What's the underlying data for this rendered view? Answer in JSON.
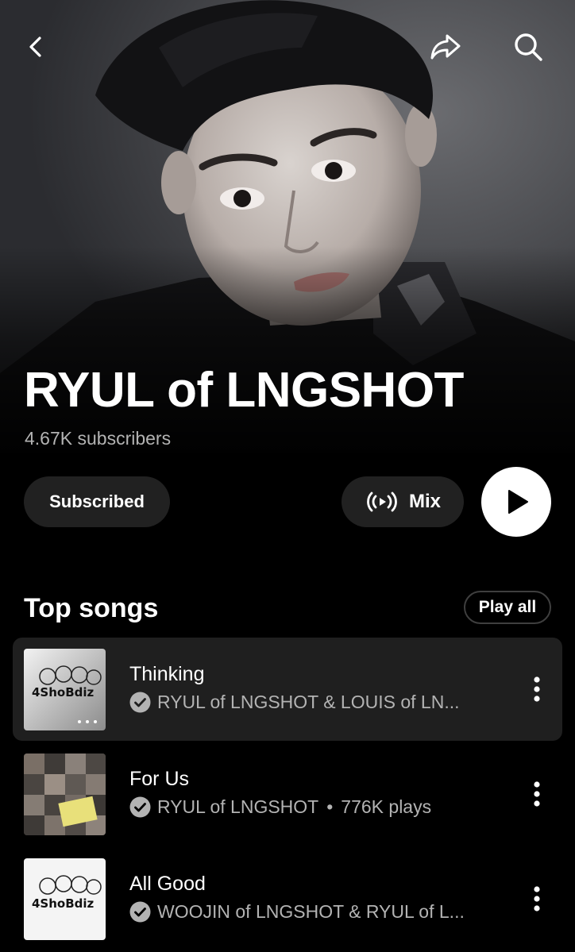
{
  "header": {
    "back_icon": "chevron-left-icon",
    "share_icon": "share-arrow-icon",
    "search_icon": "search-icon"
  },
  "artist": {
    "name": "RYUL of LNGSHOT",
    "subscribers": "4.67K subscribers"
  },
  "actions": {
    "subscribed_label": "Subscribed",
    "mix_label": "Mix",
    "mix_icon": "radio-broadcast-icon",
    "play_icon": "play-icon"
  },
  "top_songs": {
    "title": "Top songs",
    "play_all_label": "Play all",
    "songs": [
      {
        "title": "Thinking",
        "artist": "RYUL of LNGSHOT & LOUIS of LN...",
        "plays": ""
      },
      {
        "title": "For Us",
        "artist": "RYUL of LNGSHOT",
        "separator": "•",
        "plays": "776K plays"
      },
      {
        "title": "All Good",
        "artist": "WOOJIN of LNGSHOT & RYUL of L...",
        "plays": ""
      }
    ]
  },
  "colors": {
    "background": "#000000",
    "pill_bg": "#212121",
    "active_row_bg": "#1f1f1f",
    "secondary_text": "#b3b3b3",
    "play_button": "#ffffff"
  }
}
